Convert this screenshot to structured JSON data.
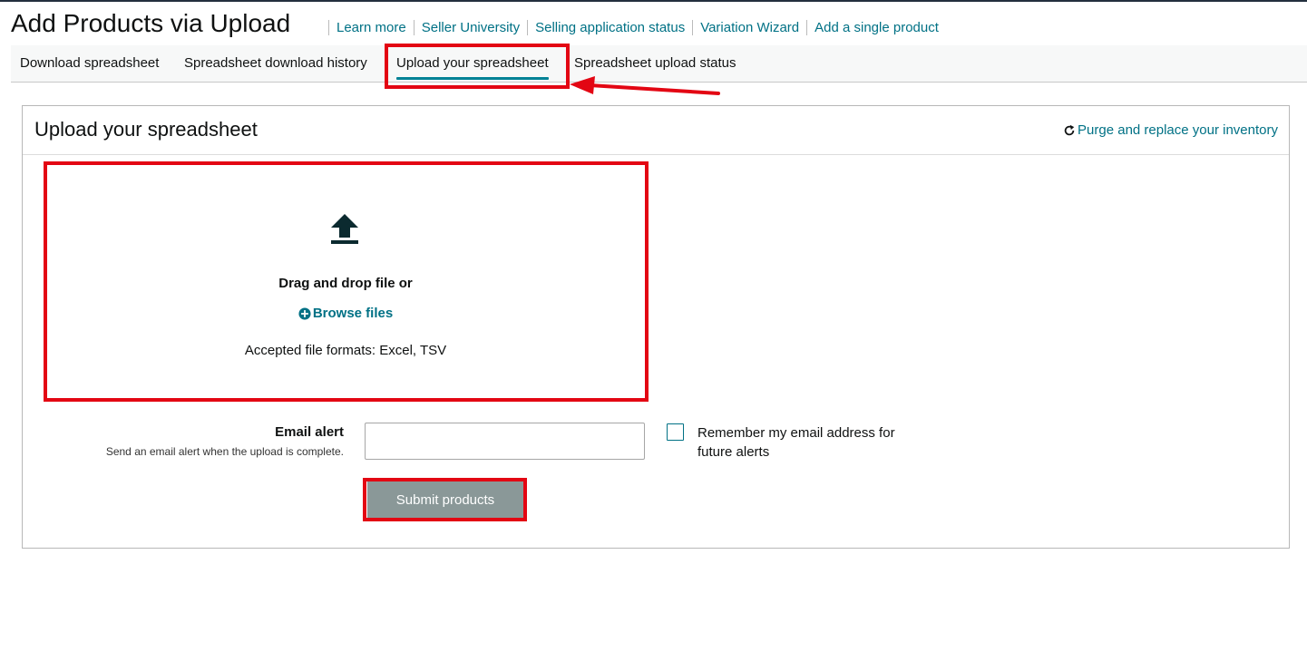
{
  "header": {
    "title": "Add Products via Upload",
    "links": [
      {
        "label": "Learn more"
      },
      {
        "label": "Seller University"
      },
      {
        "label": "Selling application status"
      },
      {
        "label": "Variation Wizard"
      },
      {
        "label": "Add a single product"
      }
    ]
  },
  "tabs": [
    {
      "label": "Download spreadsheet"
    },
    {
      "label": "Spreadsheet download history"
    },
    {
      "label": "Upload your spreadsheet",
      "active": true
    },
    {
      "label": "Spreadsheet upload status"
    }
  ],
  "panel": {
    "title": "Upload your spreadsheet",
    "purge_link": "Purge and replace your inventory",
    "dropzone": {
      "icon": "upload-arrow-icon",
      "drag_text": "Drag and drop file or",
      "browse_label": "Browse files",
      "formats_text": "Accepted file formats: Excel, TSV"
    },
    "email": {
      "label": "Email alert",
      "help": "Send an email alert when the upload is complete.",
      "value": "",
      "remember_label": "Remember my email address for future alerts",
      "remember_checked": false
    },
    "submit_label": "Submit products"
  },
  "colors": {
    "link": "#007185",
    "tab_underline": "#008296",
    "annotation": "#e30613",
    "submit_bg": "#8a9898"
  }
}
